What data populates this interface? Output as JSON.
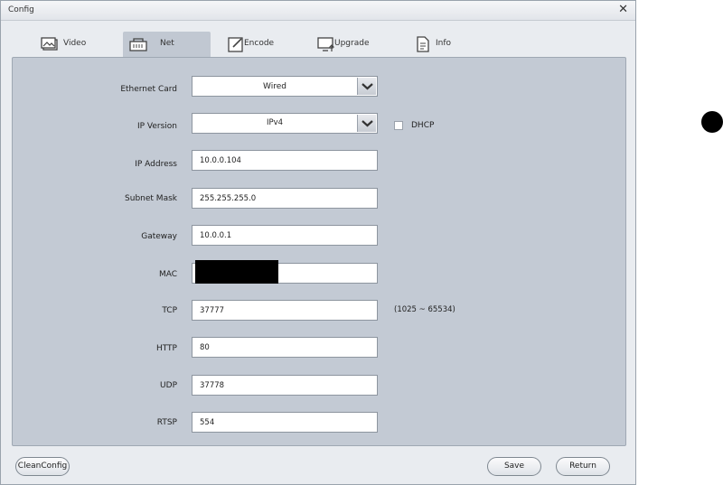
{
  "window": {
    "title": "Config"
  },
  "tabs": [
    {
      "label": "Video",
      "icon": "video-image-icon"
    },
    {
      "label": "Net",
      "icon": "network-icon",
      "active": true
    },
    {
      "label": "Encode",
      "icon": "encode-edit-icon"
    },
    {
      "label": "Upgrade",
      "icon": "upgrade-monitor-icon"
    },
    {
      "label": "Info",
      "icon": "info-document-icon"
    }
  ],
  "form": {
    "ethernet_card": {
      "label": "Ethernet Card",
      "value": "Wired"
    },
    "ip_version": {
      "label": "IP Version",
      "value": "IPv4"
    },
    "dhcp": {
      "label": "DHCP",
      "checked": false
    },
    "ip_address": {
      "label": "IP Address",
      "value": "10.0.0.104"
    },
    "subnet_mask": {
      "label": "Subnet Mask",
      "value": "255.255.255.0"
    },
    "gateway": {
      "label": "Gateway",
      "value": "10.0.0.1"
    },
    "mac": {
      "label": "MAC",
      "value": "",
      "redacted": true
    },
    "tcp": {
      "label": "TCP",
      "value": "37777",
      "hint": "(1025 ~ 65534)"
    },
    "http": {
      "label": "HTTP",
      "value": "80"
    },
    "udp": {
      "label": "UDP",
      "value": "37778"
    },
    "rtsp": {
      "label": "RTSP",
      "value": "554"
    }
  },
  "buttons": {
    "clean_config": "CleanConfig",
    "save": "Save",
    "return": "Return"
  },
  "colors": {
    "panel": "#c3cad4",
    "active_tab": "#c1c8d2",
    "window": "#e9ecf0"
  }
}
